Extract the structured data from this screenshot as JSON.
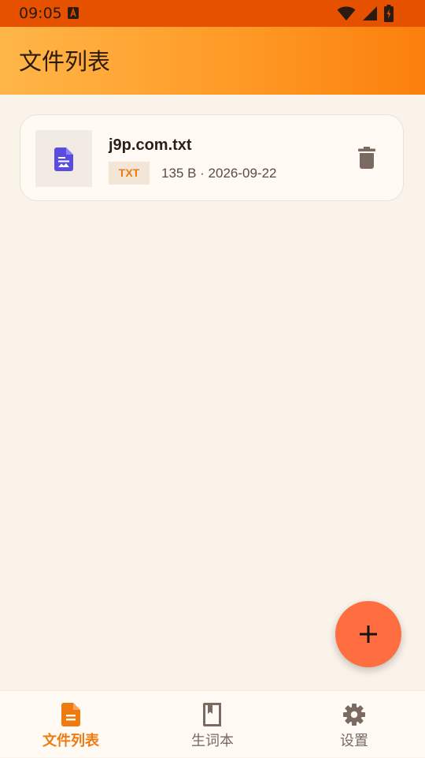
{
  "status_bar": {
    "time": "09:05",
    "app_icon": "accessibility-a-icon",
    "icons": [
      "wifi-icon",
      "cellular-signal-icon",
      "battery-charging-icon"
    ]
  },
  "app_bar": {
    "title": "文件列表",
    "gradient_colors": [
      "#ffb648",
      "#fb7f0c"
    ]
  },
  "files": [
    {
      "name": "j9p.com.txt",
      "type": "TXT",
      "meta": "135 B · 2026-09-22",
      "icon": "document-icon",
      "action_icon": "trash-icon"
    }
  ],
  "fab": {
    "icon": "plus-icon",
    "color": "#ff6e40"
  },
  "bottom_nav": {
    "items": [
      {
        "label": "文件列表",
        "icon": "file-document-icon",
        "active": true
      },
      {
        "label": "生词本",
        "icon": "book-icon",
        "active": false
      },
      {
        "label": "设置",
        "icon": "gear-icon",
        "active": false
      }
    ],
    "active_color": "#ef7a10",
    "inactive_color": "#7a6a62"
  },
  "colors": {
    "status_bar": "#e65100",
    "background": "#f9f3ea",
    "card": "#fffbf4",
    "accent": "#ef7a10",
    "doc_icon": "#5b4ce0"
  }
}
